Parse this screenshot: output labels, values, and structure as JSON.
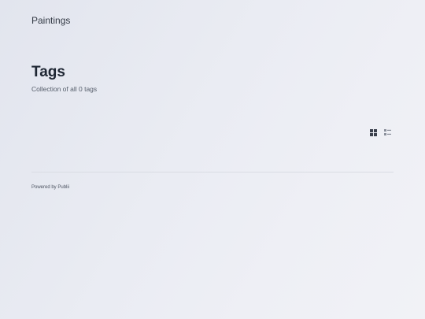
{
  "header": {
    "site_title": "Paintings"
  },
  "main": {
    "title": "Tags",
    "subtitle": "Collection of all 0 tags",
    "view_toggle": {
      "grid_icon": "grid-icon",
      "list_icon": "list-icon"
    }
  },
  "footer": {
    "powered_by": "Powered by Publii"
  },
  "colors": {
    "icon_active": "#3a404c",
    "icon_inactive": "#8a909b"
  }
}
